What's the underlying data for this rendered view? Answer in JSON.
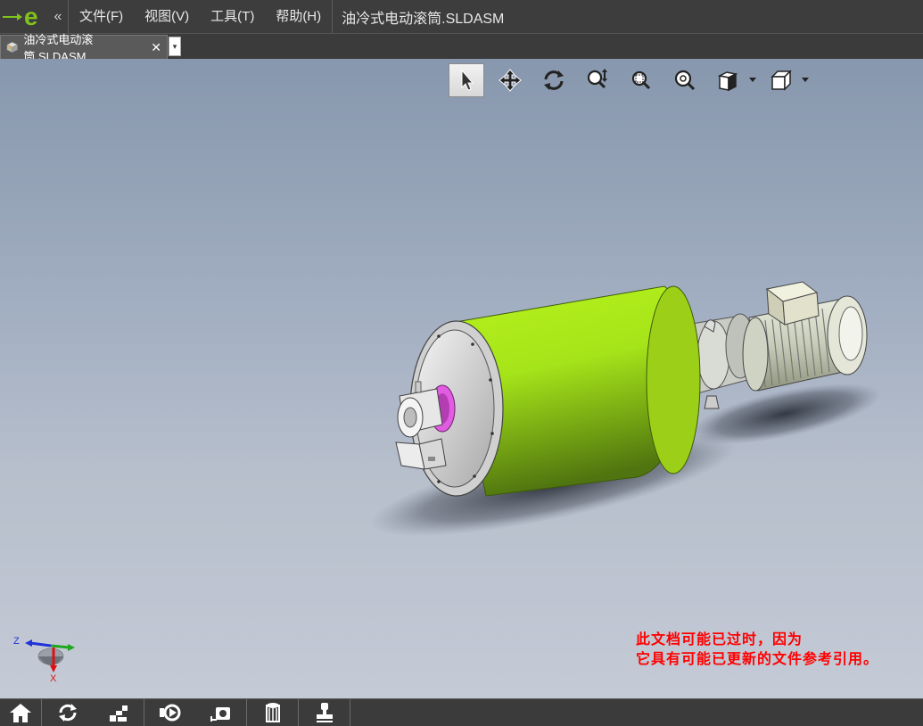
{
  "menu": {
    "file": "文件(F)",
    "view": "视图(V)",
    "tools": "工具(T)",
    "help": "帮助(H)"
  },
  "app": {
    "logo_icon": "edrawings-logo-icon",
    "collapse": "«",
    "document_title": "油冷式电动滚筒.SLDASM"
  },
  "tabs": [
    {
      "label": "油冷式电动滚筒.SLDASM",
      "close": "✕",
      "icon": "assembly-icon"
    }
  ],
  "tab_dropdown": "▾",
  "view_toolbar": [
    {
      "name": "select-tool",
      "icon": "cursor-icon"
    },
    {
      "name": "pan-tool",
      "icon": "pan-icon"
    },
    {
      "name": "rotate-tool",
      "icon": "rotate-icon"
    },
    {
      "name": "zoom-tool",
      "icon": "zoom-icon"
    },
    {
      "name": "zoom-area-tool",
      "icon": "zoom-area-icon"
    },
    {
      "name": "zoom-fit-tool",
      "icon": "zoom-fit-icon"
    },
    {
      "name": "display-style-tool",
      "icon": "display-style-icon"
    },
    {
      "name": "standard-views-tool",
      "icon": "standard-views-icon"
    }
  ],
  "warning": {
    "line1": "此文档可能已过时，因为",
    "line2": "它具有可能已更新的文件参考引用。"
  },
  "triad": {
    "x": "X",
    "z": "Z"
  },
  "bottom_toolbar": [
    {
      "name": "home",
      "icon": "home-icon"
    },
    {
      "name": "reload",
      "icon": "reload-icon"
    },
    {
      "name": "components",
      "icon": "components-icon"
    },
    {
      "name": "animate",
      "icon": "animate-icon"
    },
    {
      "name": "measure",
      "icon": "measure-icon"
    },
    {
      "name": "section",
      "icon": "section-icon"
    },
    {
      "name": "stamp",
      "icon": "stamp-icon"
    }
  ],
  "colors": {
    "drum": "#b4ee1e",
    "warning": "#ff0000",
    "topbar": "#3d3d3d",
    "logo_green": "#7fc31c"
  }
}
